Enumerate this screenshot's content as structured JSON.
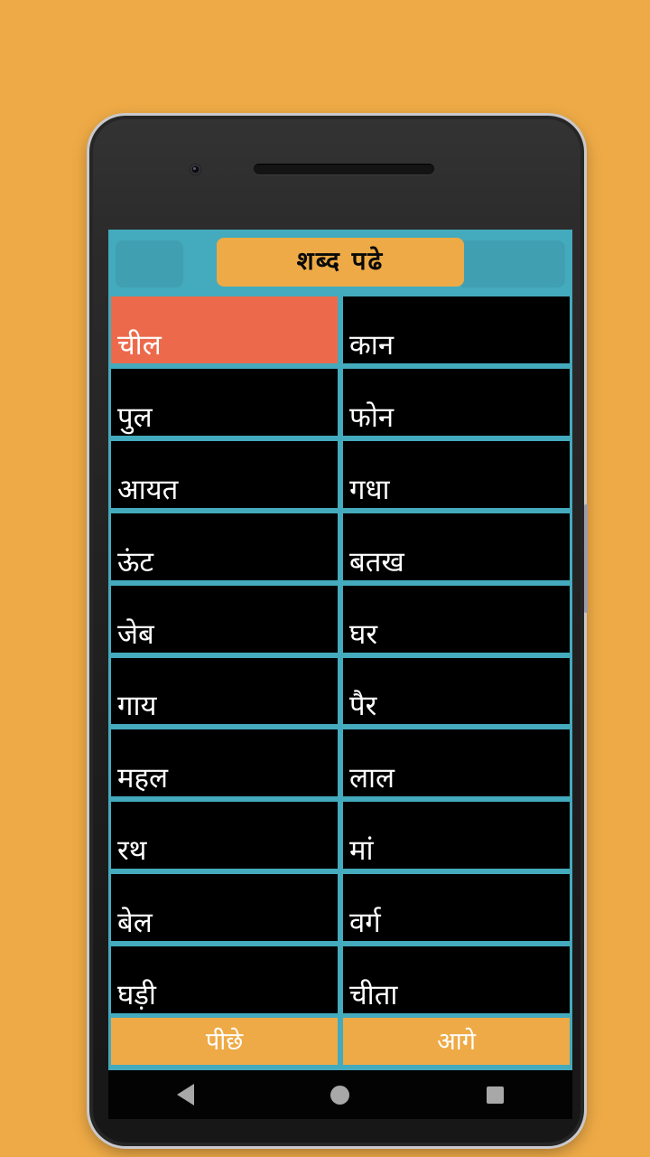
{
  "app": {
    "title": "शब्द पढे",
    "background_color": "#eeaa46",
    "accent_teal": "#44aabd",
    "accent_amber": "#eeaa46",
    "selected_color": "#ec6a4b",
    "cell_color": "#000000"
  },
  "words": {
    "rows": [
      {
        "left": "चील",
        "right": "कान"
      },
      {
        "left": "पुल",
        "right": "फोन"
      },
      {
        "left": "आयत",
        "right": "गधा"
      },
      {
        "left": "ऊंट",
        "right": "बतख"
      },
      {
        "left": "जेब",
        "right": "घर"
      },
      {
        "left": "गाय",
        "right": "पैर"
      },
      {
        "left": "महल",
        "right": "लाल"
      },
      {
        "left": "रथ",
        "right": "मां"
      },
      {
        "left": "बेल",
        "right": "वर्ग"
      },
      {
        "left": "घड़ी",
        "right": "चीता"
      }
    ],
    "selected": {
      "row": 0,
      "column": "left",
      "value": "चील"
    }
  },
  "nav": {
    "back_label": "पीछे",
    "next_label": "आगे"
  },
  "system_nav": {
    "back": "back-triangle",
    "home": "home-circle",
    "recents": "recents-square"
  }
}
